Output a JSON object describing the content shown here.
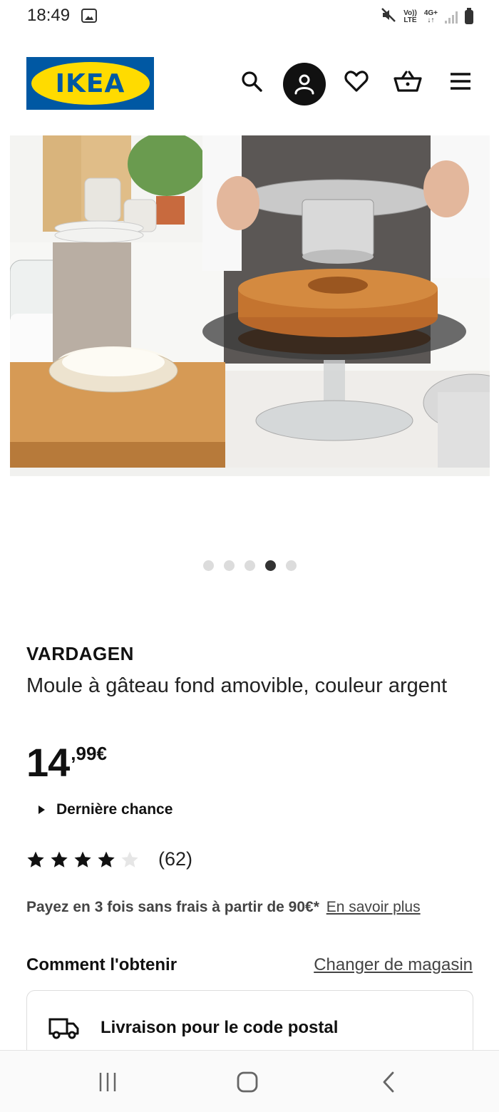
{
  "status_bar": {
    "time": "18:49",
    "network_top": "Vo))",
    "network_bottom": "LTE",
    "data_top": "4G+",
    "data_bottom": "↓↑"
  },
  "header": {
    "logo_text": "IKEA",
    "colors": {
      "brand_blue": "#0058a3",
      "brand_yellow": "#ffdb00"
    },
    "icons": [
      "search-icon",
      "account-icon",
      "heart-icon",
      "cart-icon",
      "menu-icon"
    ]
  },
  "gallery": {
    "total_images": 5,
    "active_index": 3
  },
  "product": {
    "name": "VARDAGEN",
    "description": "Moule à gâteau fond amovible, couleur argent",
    "price_integer": "14",
    "price_decimal": ",99€",
    "badge": "Dernière chance",
    "rating_value": 4,
    "rating_max": 5,
    "rating_count": "(62)"
  },
  "payment": {
    "text": "Payez en 3 fois sans frais à partir de 90€*",
    "link": "En savoir plus"
  },
  "availability": {
    "title": "Comment l'obtenir",
    "change_store": "Changer de magasin",
    "delivery_text": "Livraison pour le code postal"
  },
  "nav_bar": {
    "icons": [
      "recent-apps-icon",
      "home-icon",
      "back-icon"
    ]
  }
}
